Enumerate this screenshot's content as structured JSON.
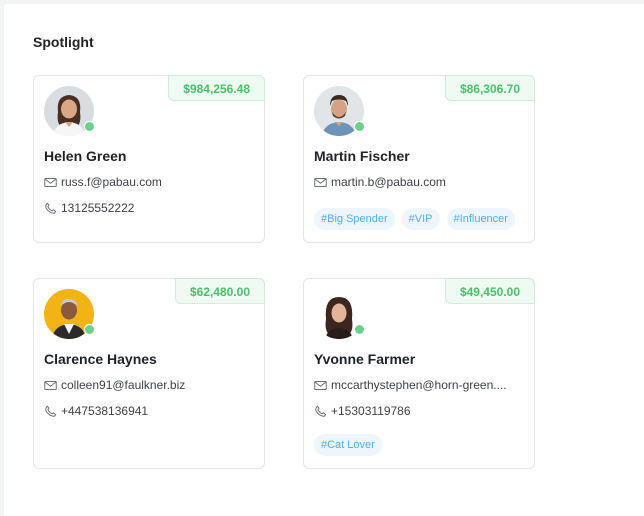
{
  "section": {
    "title": "Spotlight"
  },
  "cards": [
    {
      "amount": "$984,256.48",
      "name": "Helen Green",
      "email": "russ.f@pabau.com",
      "phone": "13125552222",
      "tags": []
    },
    {
      "amount": "$86,306.70",
      "name": "Martin Fischer",
      "email": "martin.b@pabau.com",
      "phone": "",
      "tags": [
        "#Big Spender",
        "#VIP",
        "#Influencer"
      ]
    },
    {
      "amount": "$62,480.00",
      "name": "Clarence Haynes",
      "email": "colleen91@faulkner.biz",
      "phone": "+447538136941",
      "tags": []
    },
    {
      "amount": "$49,450.00",
      "name": "Yvonne Farmer",
      "email": "mccarthystephen@horn-green....",
      "phone": "+15303119786",
      "tags": [
        "#Cat Lover"
      ]
    }
  ],
  "colors": {
    "amount_text": "#4bbf6b",
    "amount_bg": "#eefaf2",
    "tag_text": "#53aee3",
    "tag_bg": "#eef6fd",
    "online_dot": "#6fcf8e"
  },
  "icons": {
    "email": "mail-icon",
    "phone": "phone-icon",
    "status": "online-status-icon"
  }
}
